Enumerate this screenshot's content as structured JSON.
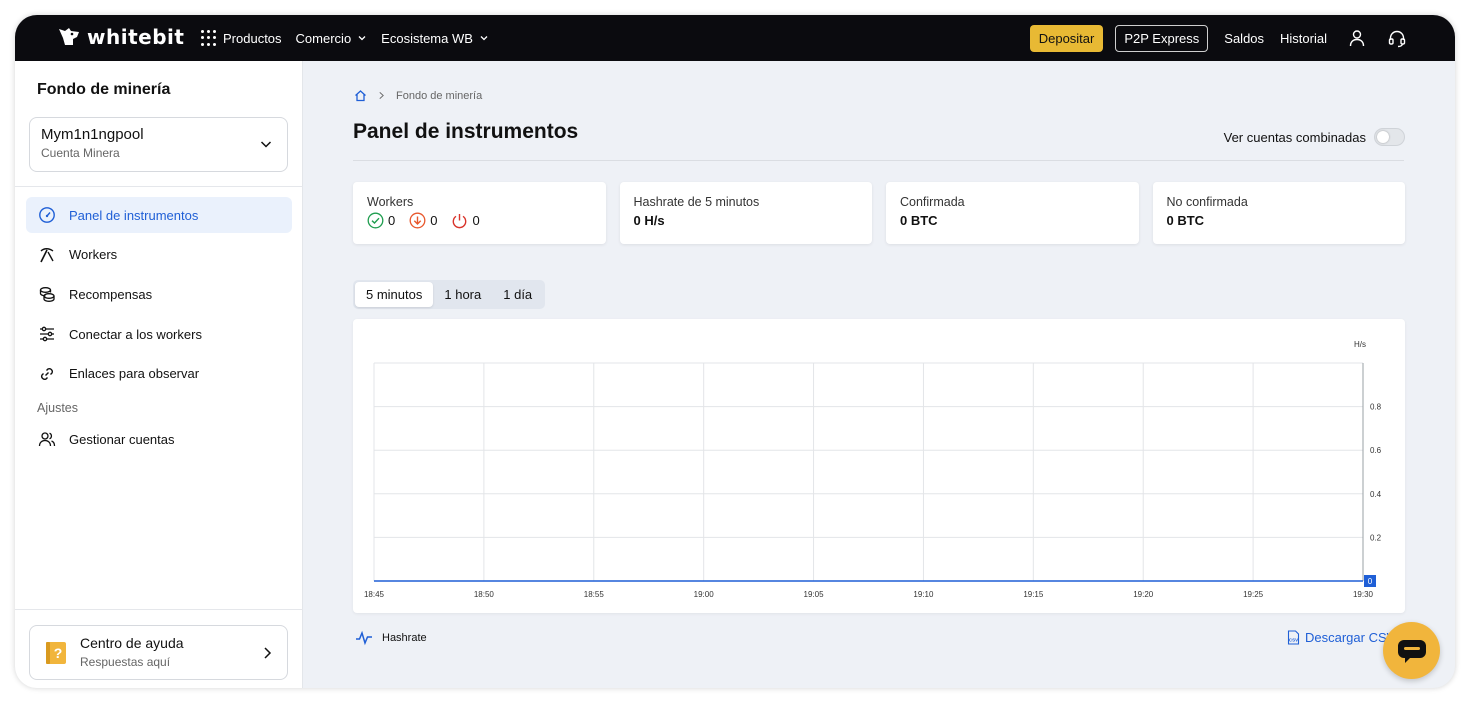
{
  "brand": {
    "name": "whitebit"
  },
  "nav": {
    "left": [
      {
        "label": "Productos",
        "icon": "apps-grid-icon"
      },
      {
        "label": "Comercio",
        "icon": "chevron-down-icon"
      },
      {
        "label": "Ecosistema WB",
        "icon": "chevron-down-icon"
      }
    ],
    "deposit_label": "Depositar",
    "p2p_label": "P2P Express",
    "balances_label": "Saldos",
    "history_label": "Historial"
  },
  "sidebar": {
    "title": "Fondo de minería",
    "account": {
      "name": "Mym1n1ngpool",
      "subtitle": "Cuenta Minera"
    },
    "items": [
      {
        "label": "Panel de instrumentos",
        "icon": "dashboard-gauge-icon",
        "active": true
      },
      {
        "label": "Workers",
        "icon": "pickaxe-icon"
      },
      {
        "label": "Recompensas",
        "icon": "coins-icon"
      },
      {
        "label": "Conectar a los workers",
        "icon": "sliders-icon"
      },
      {
        "label": "Enlaces para observar",
        "icon": "link-icon"
      }
    ],
    "settings_section": "Ajustes",
    "settings_items": [
      {
        "label": "Gestionar cuentas",
        "icon": "users-icon"
      }
    ],
    "help": {
      "title": "Centro de ayuda",
      "subtitle": "Respuestas aquí"
    }
  },
  "main": {
    "breadcrumb": {
      "current": "Fondo de minería"
    },
    "title": "Panel de instrumentos",
    "combined_label": "Ver cuentas combinadas",
    "combined_on": false,
    "stats": {
      "workers": {
        "label": "Workers",
        "active": "0",
        "inactive": "0",
        "offline": "0"
      },
      "hashrate": {
        "label": "Hashrate de 5 minutos",
        "value": "0 H/s"
      },
      "confirmed": {
        "label": "Confirmada",
        "value": "0 BTC"
      },
      "unconfirmed": {
        "label": "No confirmada",
        "value": "0 BTC"
      }
    },
    "tabs": [
      {
        "label": "5 minutos",
        "active": true
      },
      {
        "label": "1 hora"
      },
      {
        "label": "1 día"
      }
    ],
    "legend_label": "Hashrate",
    "download_label": "Descargar CSV"
  },
  "colors": {
    "accent": "#e8b934",
    "link_blue": "#1f5fd6",
    "series_blue": "#1f5fd6",
    "success_green": "#1f9d4f",
    "warning_orange": "#e8572c",
    "danger_red": "#d9342b"
  },
  "chart_data": {
    "type": "line",
    "ylabel": "H/s",
    "x": [
      "18:45",
      "18:50",
      "18:55",
      "19:00",
      "19:05",
      "19:10",
      "19:15",
      "19:20",
      "19:25",
      "19:30"
    ],
    "series": [
      {
        "name": "Hashrate",
        "values": [
          0,
          0,
          0,
          0,
          0,
          0,
          0,
          0,
          0,
          0
        ]
      }
    ],
    "y_ticks": [
      "0.2",
      "0.4",
      "0.6",
      "0.8"
    ],
    "ylim": [
      0,
      1
    ],
    "last_value_label": "0",
    "grid": true,
    "y_axis_side": "right"
  }
}
